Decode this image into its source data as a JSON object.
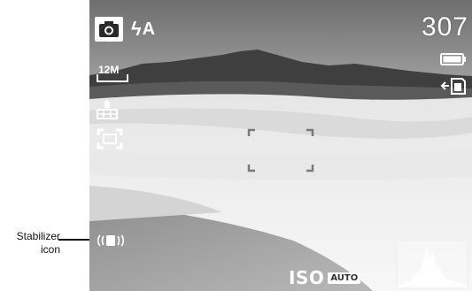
{
  "annotation": {
    "label_line1": "Stabilizer",
    "label_line2": "icon"
  },
  "camera": {
    "shots_remaining": "307",
    "flash_mode": "A",
    "image_size": "12M",
    "iso_label": "ISO",
    "iso_value": "AUTO",
    "battery_level": 1.0,
    "icons": {
      "mode": "camera-icon",
      "flash": "flash-bolt-icon",
      "size": "image-size-icon",
      "battery": "battery-icon",
      "storage": "memory-card-icon",
      "quality": "quality-icon",
      "af": "autofocus-icon",
      "stabilizer": "stabilizer-icon",
      "histogram": "histogram-icon"
    }
  }
}
